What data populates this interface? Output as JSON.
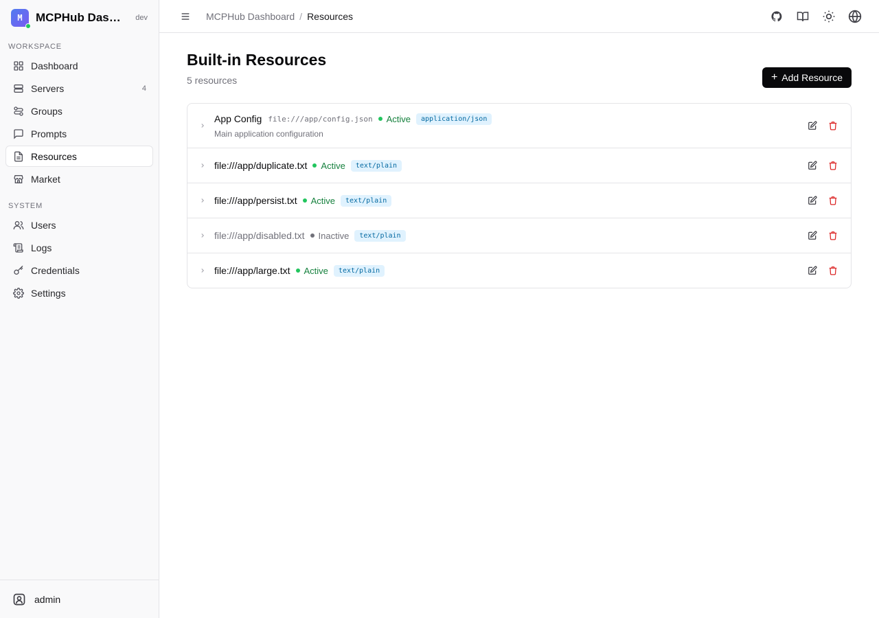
{
  "brand": {
    "logo_letter": "M",
    "title": "MCPHub Dashboard",
    "env": "dev"
  },
  "sidebar": {
    "workspace_label": "WORKSPACE",
    "workspace_items": [
      {
        "label": "Dashboard",
        "icon": "grid-icon"
      },
      {
        "label": "Servers",
        "icon": "server-icon",
        "badge": "4"
      },
      {
        "label": "Groups",
        "icon": "groups-icon"
      },
      {
        "label": "Prompts",
        "icon": "message-icon"
      },
      {
        "label": "Resources",
        "icon": "file-text-icon",
        "active": true
      },
      {
        "label": "Market",
        "icon": "store-icon"
      }
    ],
    "system_label": "SYSTEM",
    "system_items": [
      {
        "label": "Users",
        "icon": "users-icon"
      },
      {
        "label": "Logs",
        "icon": "scroll-icon"
      },
      {
        "label": "Credentials",
        "icon": "key-icon"
      },
      {
        "label": "Settings",
        "icon": "gear-icon"
      }
    ],
    "footer_user": "admin"
  },
  "topbar": {
    "breadcrumb_root": "MCPHub Dashboard",
    "breadcrumb_sep": "/",
    "breadcrumb_current": "Resources"
  },
  "page": {
    "title": "Built-in Resources",
    "subtitle": "5 resources",
    "add_button": "Add Resource"
  },
  "resources": [
    {
      "name": "App Config",
      "uri": "file:///app/config.json",
      "status": "Active",
      "mime": "application/json",
      "description": "Main application configuration"
    },
    {
      "name": "file:///app/duplicate.txt",
      "status": "Active",
      "mime": "text/plain"
    },
    {
      "name": "file:///app/persist.txt",
      "status": "Active",
      "mime": "text/plain"
    },
    {
      "name": "file:///app/disabled.txt",
      "status": "Inactive",
      "mime": "text/plain"
    },
    {
      "name": "file:///app/large.txt",
      "status": "Active",
      "mime": "text/plain"
    }
  ],
  "colors": {
    "accent": "#09090b",
    "active_status": "#15803d",
    "active_dot": "#22c55e",
    "inactive_status": "#71717a",
    "mime_bg": "#e0f2fe",
    "mime_text": "#0369a1",
    "delete": "#dc2626"
  }
}
